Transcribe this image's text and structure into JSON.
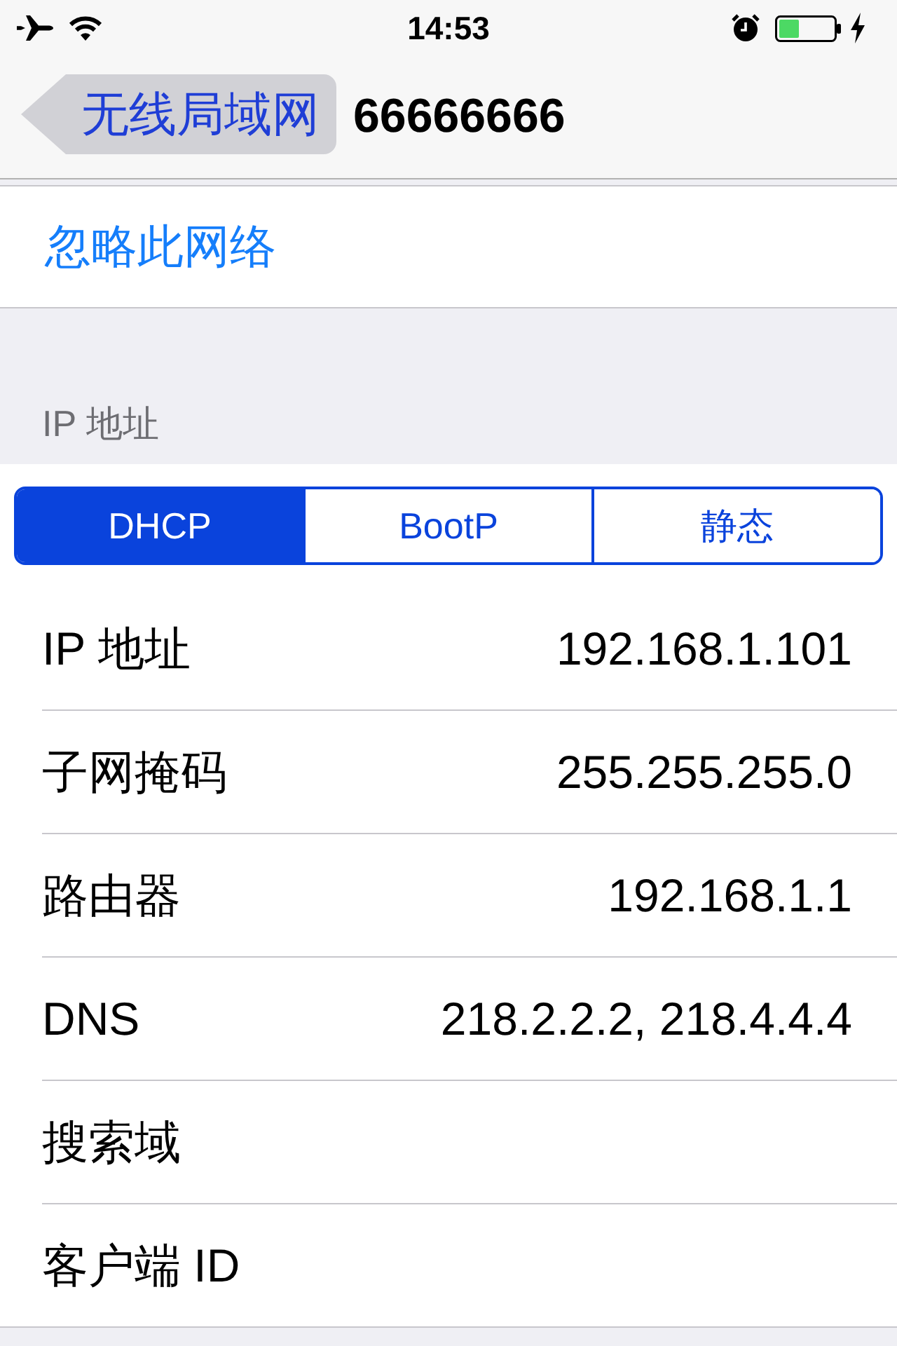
{
  "status_bar": {
    "time": "14:53"
  },
  "nav_bar": {
    "back_label": "无线局域网",
    "title": "66666666"
  },
  "forget_network": {
    "label": "忽略此网络"
  },
  "ip_section": {
    "header": "IP 地址",
    "segments": [
      {
        "label": "DHCP",
        "selected": true
      },
      {
        "label": "BootP",
        "selected": false
      },
      {
        "label": "静态",
        "selected": false
      }
    ],
    "rows": [
      {
        "label": "IP 地址",
        "value": "192.168.1.101"
      },
      {
        "label": "子网掩码",
        "value": "255.255.255.0"
      },
      {
        "label": "路由器",
        "value": "192.168.1.1"
      },
      {
        "label": "DNS",
        "value": "218.2.2.2, 218.4.4.4"
      },
      {
        "label": "搜索域"
      },
      {
        "label": "客户端 ID"
      }
    ]
  }
}
